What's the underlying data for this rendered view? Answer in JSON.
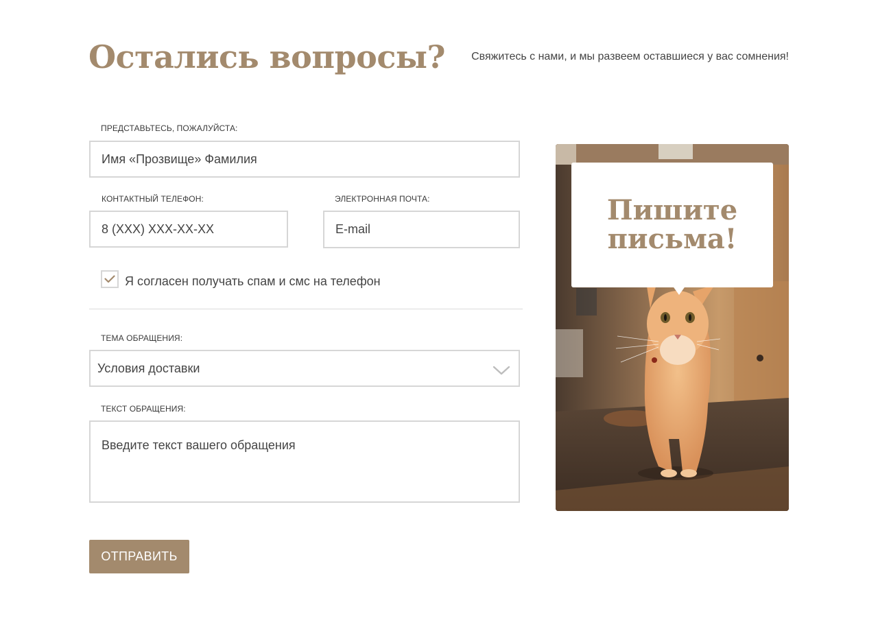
{
  "header": {
    "title": "Остались вопросы?",
    "subtitle": "Свяжитесь с нами, и мы развеем оставшиеся у вас сомнения!"
  },
  "form": {
    "name": {
      "label": "ПРЕДСТАВЬТЕСЬ, ПОЖАЛУЙСТА:",
      "placeholder": "Имя «Прозвище» Фамилия"
    },
    "phone": {
      "label": "КОНТАКТНЫЙ ТЕЛЕФОН:",
      "placeholder": "8 (XXX) XXX-XX-XX"
    },
    "email": {
      "label": "ЭЛЕКТРОННАЯ ПОЧТА:",
      "placeholder": "E-mail"
    },
    "consent": {
      "label": "Я согласен получать спам и смс на телефон",
      "checked": true
    },
    "topic": {
      "label": "ТЕМА ОБРАЩЕНИЯ:",
      "selected": "Условия доставки"
    },
    "message": {
      "label": "ТЕКСТ ОБРАЩЕНИЯ:",
      "placeholder": "Введите текст вашего обращения"
    },
    "submit_label": "ОТПРАВИТЬ"
  },
  "promo": {
    "heading": "Пишите письма!",
    "image": "cat-photo"
  },
  "colors": {
    "accent": "#a38a6d",
    "input_border": "#d6d6d6",
    "text": "#444444"
  },
  "icons": {
    "checkbox": "check-icon",
    "select": "chevron-down-icon"
  }
}
